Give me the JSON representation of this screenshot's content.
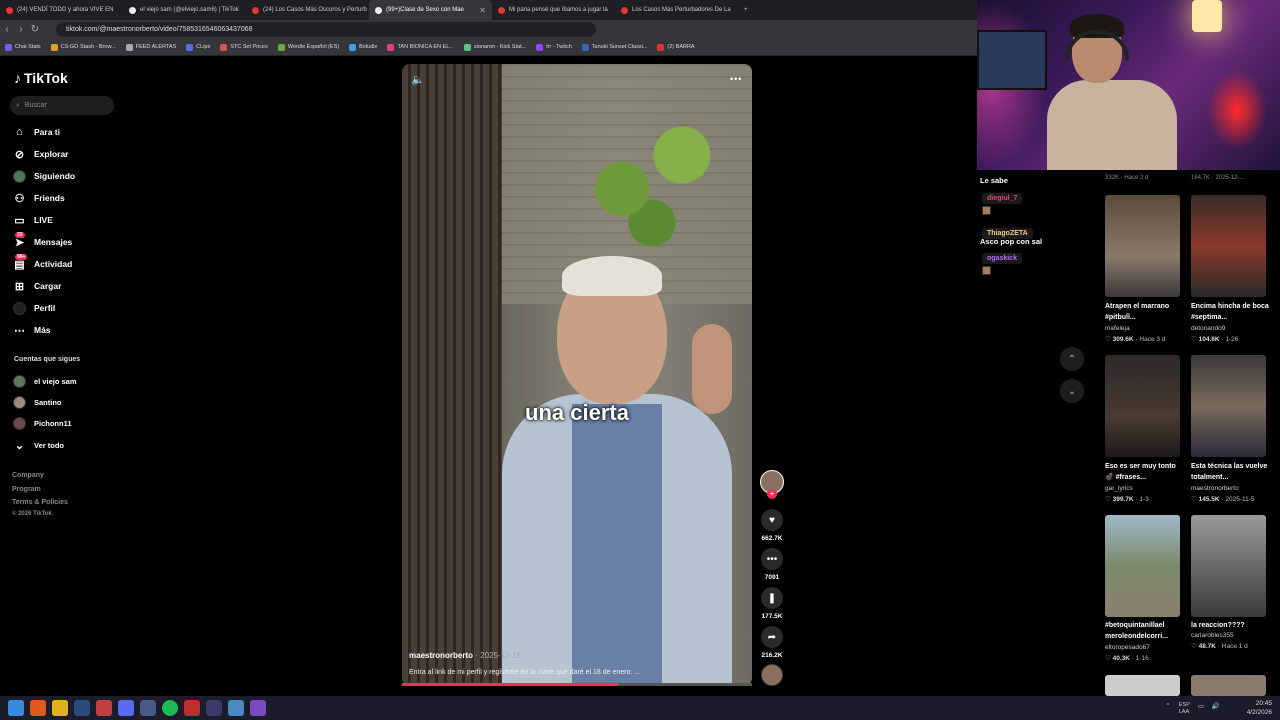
{
  "browser": {
    "tabs": [
      {
        "title": "(24) VENDÍ TODO y ahora VIVE EN",
        "active": false
      },
      {
        "title": "el viejo sam (@elviejo.sam6) | TikTok",
        "active": false
      },
      {
        "title": "(24) Los Casos Más Oscuros y Perturb",
        "active": false
      },
      {
        "title": "(99+)Clase de Sexo con Mae",
        "active": true
      },
      {
        "title": "Mi pana pensé que íbamos a jugar la",
        "active": false
      },
      {
        "title": "Los Casos Más Perturbadores De La",
        "active": false
      }
    ],
    "new_tab": "+",
    "url": "tiktok.com/@maestronorberto/video/7585316546063437068",
    "bookmarks": [
      "Chat Stats",
      "CS:GO Stash - Brow...",
      "FEED ALERTAS",
      "CLips",
      "STC Set Prices",
      "Wordle Español (ES)",
      "Boludle",
      "TAN BIONICA EN EL...",
      "sionaron - Kick Stat...",
      "trr - Twitch",
      "Tanuki Sunset Classi...",
      "(2) BARRA"
    ]
  },
  "tiktok": {
    "logo": "TikTok",
    "search_placeholder": "Buscar",
    "nav": [
      {
        "label": "Para ti",
        "icon": "home-icon",
        "badge": ""
      },
      {
        "label": "Explorar",
        "icon": "compass-icon",
        "badge": ""
      },
      {
        "label": "Siguiendo",
        "icon": "avatar-icon",
        "badge": ""
      },
      {
        "label": "Friends",
        "icon": "friends-icon",
        "badge": ""
      },
      {
        "label": "LIVE",
        "icon": "live-icon",
        "badge": ""
      },
      {
        "label": "Mensajes",
        "icon": "message-icon",
        "badge": "33"
      },
      {
        "label": "Actividad",
        "icon": "activity-icon",
        "badge": "99+"
      },
      {
        "label": "Cargar",
        "icon": "upload-icon",
        "badge": ""
      },
      {
        "label": "Perfil",
        "icon": "profile-icon",
        "badge": ""
      },
      {
        "label": "Más",
        "icon": "more-icon",
        "badge": ""
      }
    ],
    "following_title": "Cuentas que sigues",
    "following": [
      "el viejo sam",
      "Santino",
      "Pichonn11"
    ],
    "see_all": "Ver todo",
    "footer": [
      "Company",
      "Program",
      "Terms & Policies",
      "© 2026 TikTok"
    ],
    "video": {
      "caption": "una cierta",
      "author": "maestronorberto",
      "date": "· 2025-12-18",
      "description": "Entra al link de mi perfil y regístrate en la clase que daré el 18 de enero. ...",
      "likes": "662.7K",
      "comments": "7091",
      "saves": "177.5K",
      "shares": "216.2K",
      "progress": 0.62
    }
  },
  "chat": {
    "title": "Le sabe",
    "messages": [
      {
        "user": "diegiul_7",
        "color": "#e04a6a"
      },
      {
        "user": "ThiagoZETA",
        "color": "#f0d080",
        "text": "Asco pop con sal"
      },
      {
        "user": "ogaskick",
        "color": "#b070ff"
      }
    ]
  },
  "suggested": {
    "top_meta": [
      "332K · Hace 2 d",
      "184.7K · 2025-12-..."
    ],
    "cards": [
      {
        "title": "Atrapen el marrano #pitbull...",
        "author": "mafeleja",
        "views": "309.6K",
        "when": "Hace 3 d"
      },
      {
        "title": "Encima hincha de boca #septima...",
        "author": "detonando9",
        "views": "104.6K",
        "when": "1-26"
      },
      {
        "title": "Eso es ser muy tonto 💣 #frases...",
        "author": "gar_lyrics",
        "views": "399.7K",
        "when": "1-3"
      },
      {
        "title": "Esta técnica las vuelve totalment...",
        "author": "maestronorberto",
        "views": "145.5K",
        "when": "2025-11-5"
      },
      {
        "title": "#betoquintanillael meroleondelcorri...",
        "author": "eltoropesado67",
        "views": "40.3K",
        "when": "1-16"
      },
      {
        "title": "la reaccion????",
        "author": "carlarobles355",
        "views": "48.7K",
        "when": "Hace 1 d"
      }
    ]
  },
  "taskbar": {
    "lang": "ESP\nLAA",
    "time": "20:45",
    "date": "4/2/2026"
  }
}
